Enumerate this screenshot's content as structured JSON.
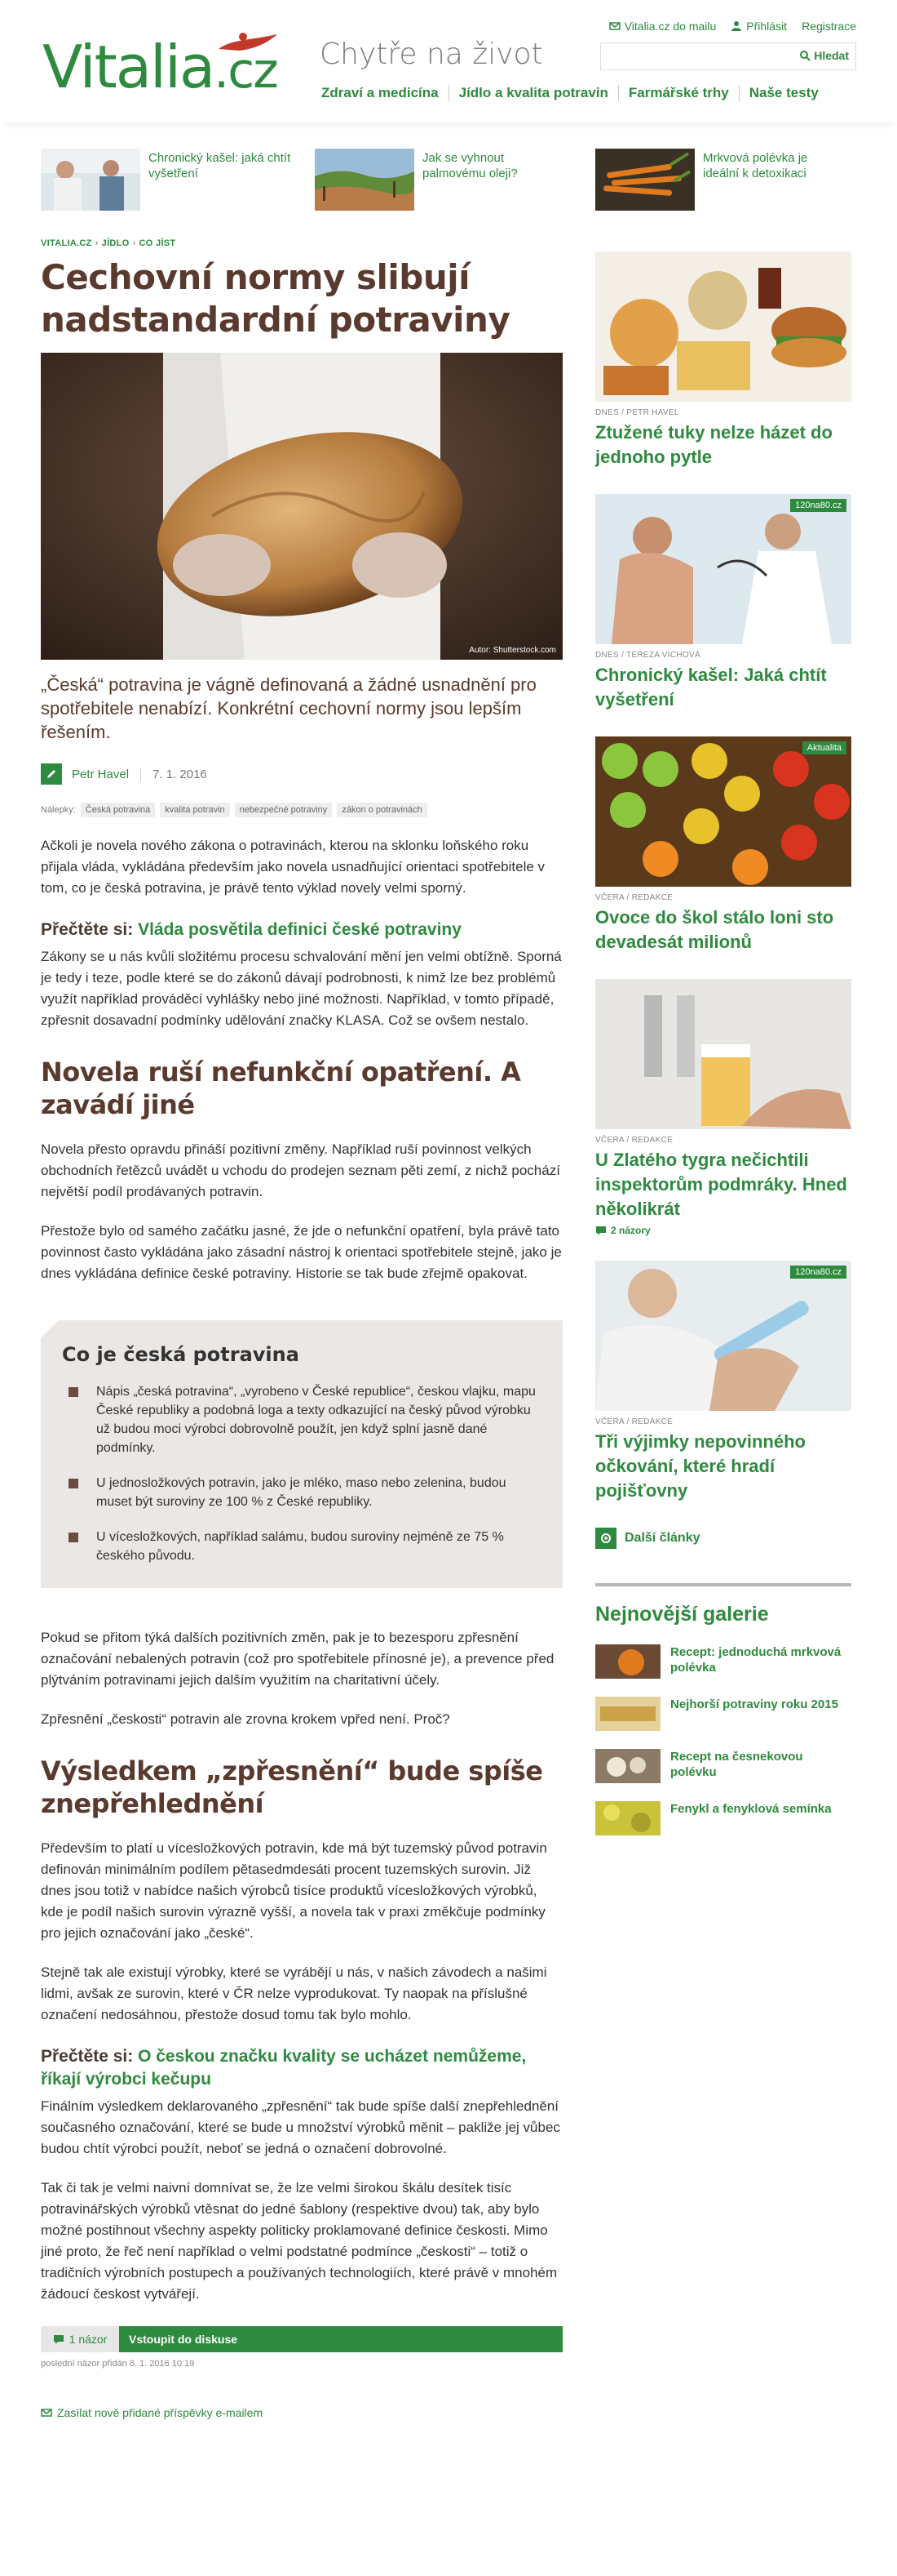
{
  "header": {
    "logo_main": "Vitalia",
    "logo_tld": ".cz",
    "tagline": "Chytře na život",
    "toplinks": {
      "mail": "Vitalia.cz do mailu",
      "login": "Přihlásit",
      "register": "Registrace"
    },
    "search": {
      "placeholder": "",
      "button": "Hledat"
    },
    "nav": [
      "Zdraví a medicína",
      "Jídlo a kvalita potravin",
      "Farmářské trhy",
      "Naše testy"
    ]
  },
  "teasers": [
    {
      "title": "Chronický kašel: jaká chtít vyšetření"
    },
    {
      "title": "Jak se vyhnout palmovému oleji?"
    },
    {
      "title": "Mrkvová polévka je ideální k detoxikaci"
    }
  ],
  "article": {
    "breadcrumbs": [
      "VITALIA.CZ",
      "JÍDLO",
      "CO JÍST"
    ],
    "title": "Cechovní normy slibují nadstandardní potraviny",
    "photo_credit": "Autor: Shutterstock.com",
    "perex": "„Česká“ potravina je vágně definovaná a žádné usnadnění pro spotřebitele nenabízí. Konkrétní cechovní normy jsou lepším řešením.",
    "author": "Petr Havel",
    "date": "7. 1. 2016",
    "tags_label": "Nálepky:",
    "tags": [
      "Česká potravina",
      "kvalita potravin",
      "nebezpečné potraviny",
      "zákon o potravinách"
    ],
    "p1": "Ačkoli je novela nového zákona o potravinách, kterou na sklonku loňského roku přijala vláda, vykládána především jako novela usnadňující orientaci spotřebitele v tom, co je česká potravina, je právě tento výklad novely velmi sporný.",
    "readalso1_prefix": "Přečtěte si:",
    "readalso1_link": "Vláda posvětila definici české potraviny",
    "p2": "Zákony se u nás kvůli složitému procesu schvalování mění jen velmi obtížně. Sporná je tedy i teze, podle které se do zákonů dávají podrobnosti, k nimž lze bez problémů využít například prováděcí vyhlášky nebo jiné možnosti. Například, v tomto případě, zpřesnit dosavadní podmínky udělování značky KLASA. Což se ovšem nestalo.",
    "h2_1": "Novela ruší nefunkční opatření. A zavádí jiné",
    "p3": "Novela přesto opravdu přináší pozitivní změny. Například ruší povinnost velkých obchodních řetězců uvádět u vchodu do prodejen seznam pěti zemí, z nichž pochází největší podíl prodávaných potravin.",
    "p4": "Přestože bylo od samého začátku jasné, že jde o nefunkční opatření, byla právě tato povinnost často vykládána jako zásadní nástroj k orientaci spotřebitele stejně, jako je dnes vykládána definice české potraviny. Historie se tak bude zřejmě opakovat.",
    "box": {
      "title": "Co je česká potravina",
      "items": [
        "Nápis „česká potravina“, „vyrobeno v České republice“, českou vlajku, mapu České republiky a podobná loga a texty odkazující na český původ výrobku už budou moci výrobci dobrovolně použít, jen když splní jasně dané podmínky.",
        "U jednosložkových potravin, jako je mléko, maso nebo zelenina, budou muset být suroviny ze 100 % z České republiky.",
        "U vícesložkových, například salámu, budou suroviny nejméně ze 75 % českého původu."
      ]
    },
    "p5": "Pokud se přitom týká dalších pozitivních změn, pak je to bezesporu zpřesnění označování nebalených potravin (což pro spotřebitele přínosné je), a prevence před plýtváním potravinami jejich dalším využitím na charitativní účely.",
    "p6": "Zpřesnění „českosti“ potravin ale zrovna krokem vpřed není. Proč?",
    "h2_2": "Výsledkem „zpřesnění“ bude spíše znepřehlednění",
    "p7": "Především to platí u vícesložkových potravin, kde má být tuzemský původ potravin definován minimálním podílem pětasedmdesáti procent tuzemských surovin. Již dnes jsou totiž v nabídce našich výrobců tisíce produktů vícesložkových výrobků, kde je podíl našich surovin výrazně vyšší, a novela tak v praxi změkčuje podmínky pro jejich označování jako „české“.",
    "p8": "Stejně tak ale existují výrobky, které se vyrábějí u nás, v našich závodech a našimi lidmi, avšak ze surovin, které v ČR nelze vyprodukovat. Ty naopak na příslušné označení nedosáhnou, přestože dosud tomu tak bylo mohlo.",
    "readalso2_prefix": "Přečtěte si:",
    "readalso2_link": "O českou značku kvality se ucházet nemůžeme, říkají výrobci kečupu",
    "p9": "Finálním výsledkem deklarovaného „zpřesnění“ tak bude spíše další znepřehlednění současného označování, které se bude u množství výrobků měnit – pakliže jej vůbec budou chtít výrobci použít, neboť se jedná o označení dobrovolné.",
    "p10": "Tak či tak je velmi naivní domnívat se, že lze velmi širokou škálu desítek tisíc potravinářských výrobků vtěsnat do jedné šablony (respektive dvou) tak, aby bylo možné postihnout všechny aspekty politicky proklamované definice českosti. Mimo jiné proto, že řeč není například o velmi podstatné podmínce „českosti“ – totiž o tradičních výrobních postupech a používaných technologiích, které právě v mnohém žádoucí českost vytvářejí.",
    "discussion": {
      "count": "1 názor",
      "join": "Vstoupit do diskuse",
      "last": "poslední názor přidán 8. 1. 2016 10:19"
    },
    "subscribe": "Zasílat nově přidané příspěvky e-mailem"
  },
  "sidebar": {
    "cards": [
      {
        "meta": "DNES / PETR HAVEL",
        "title": "Ztužené tuky nelze házet do jednoho pytle",
        "badge": "",
        "comments": ""
      },
      {
        "meta": "DNES / TEREZA VÍCHOVÁ",
        "title": "Chronický kašel: Jaká chtít vyšetření",
        "badge": "120na80.cz",
        "comments": ""
      },
      {
        "meta": "VČERA / REDAKCE",
        "title": "Ovoce do škol stálo loni sto devadesát milionů",
        "badge": "Aktualita",
        "comments": ""
      },
      {
        "meta": "VČERA / REDAKCE",
        "title": "U Zlatého tygra nečichtili inspektorům podmráky. Hned několikrát",
        "badge": "",
        "comments": "2 názory"
      },
      {
        "meta": "VČERA / REDAKCE",
        "title": "Tři výjimky nepovinného očkování, které hradí pojišťovny",
        "badge": "120na80.cz",
        "comments": ""
      }
    ],
    "more": "Další články",
    "gallery_title": "Nejnovější galerie",
    "gallery": [
      "Recept: jednoduchá mrkvová polévka",
      "Nejhorší potraviny roku 2015",
      "Recept na česnekovou polévku",
      "Fenykl a fenyklová semínka"
    ]
  },
  "colors": {
    "brand_green": "#2e8a3e",
    "heading_brown": "#5a3a2e",
    "box_bg": "#ebe7e4"
  }
}
